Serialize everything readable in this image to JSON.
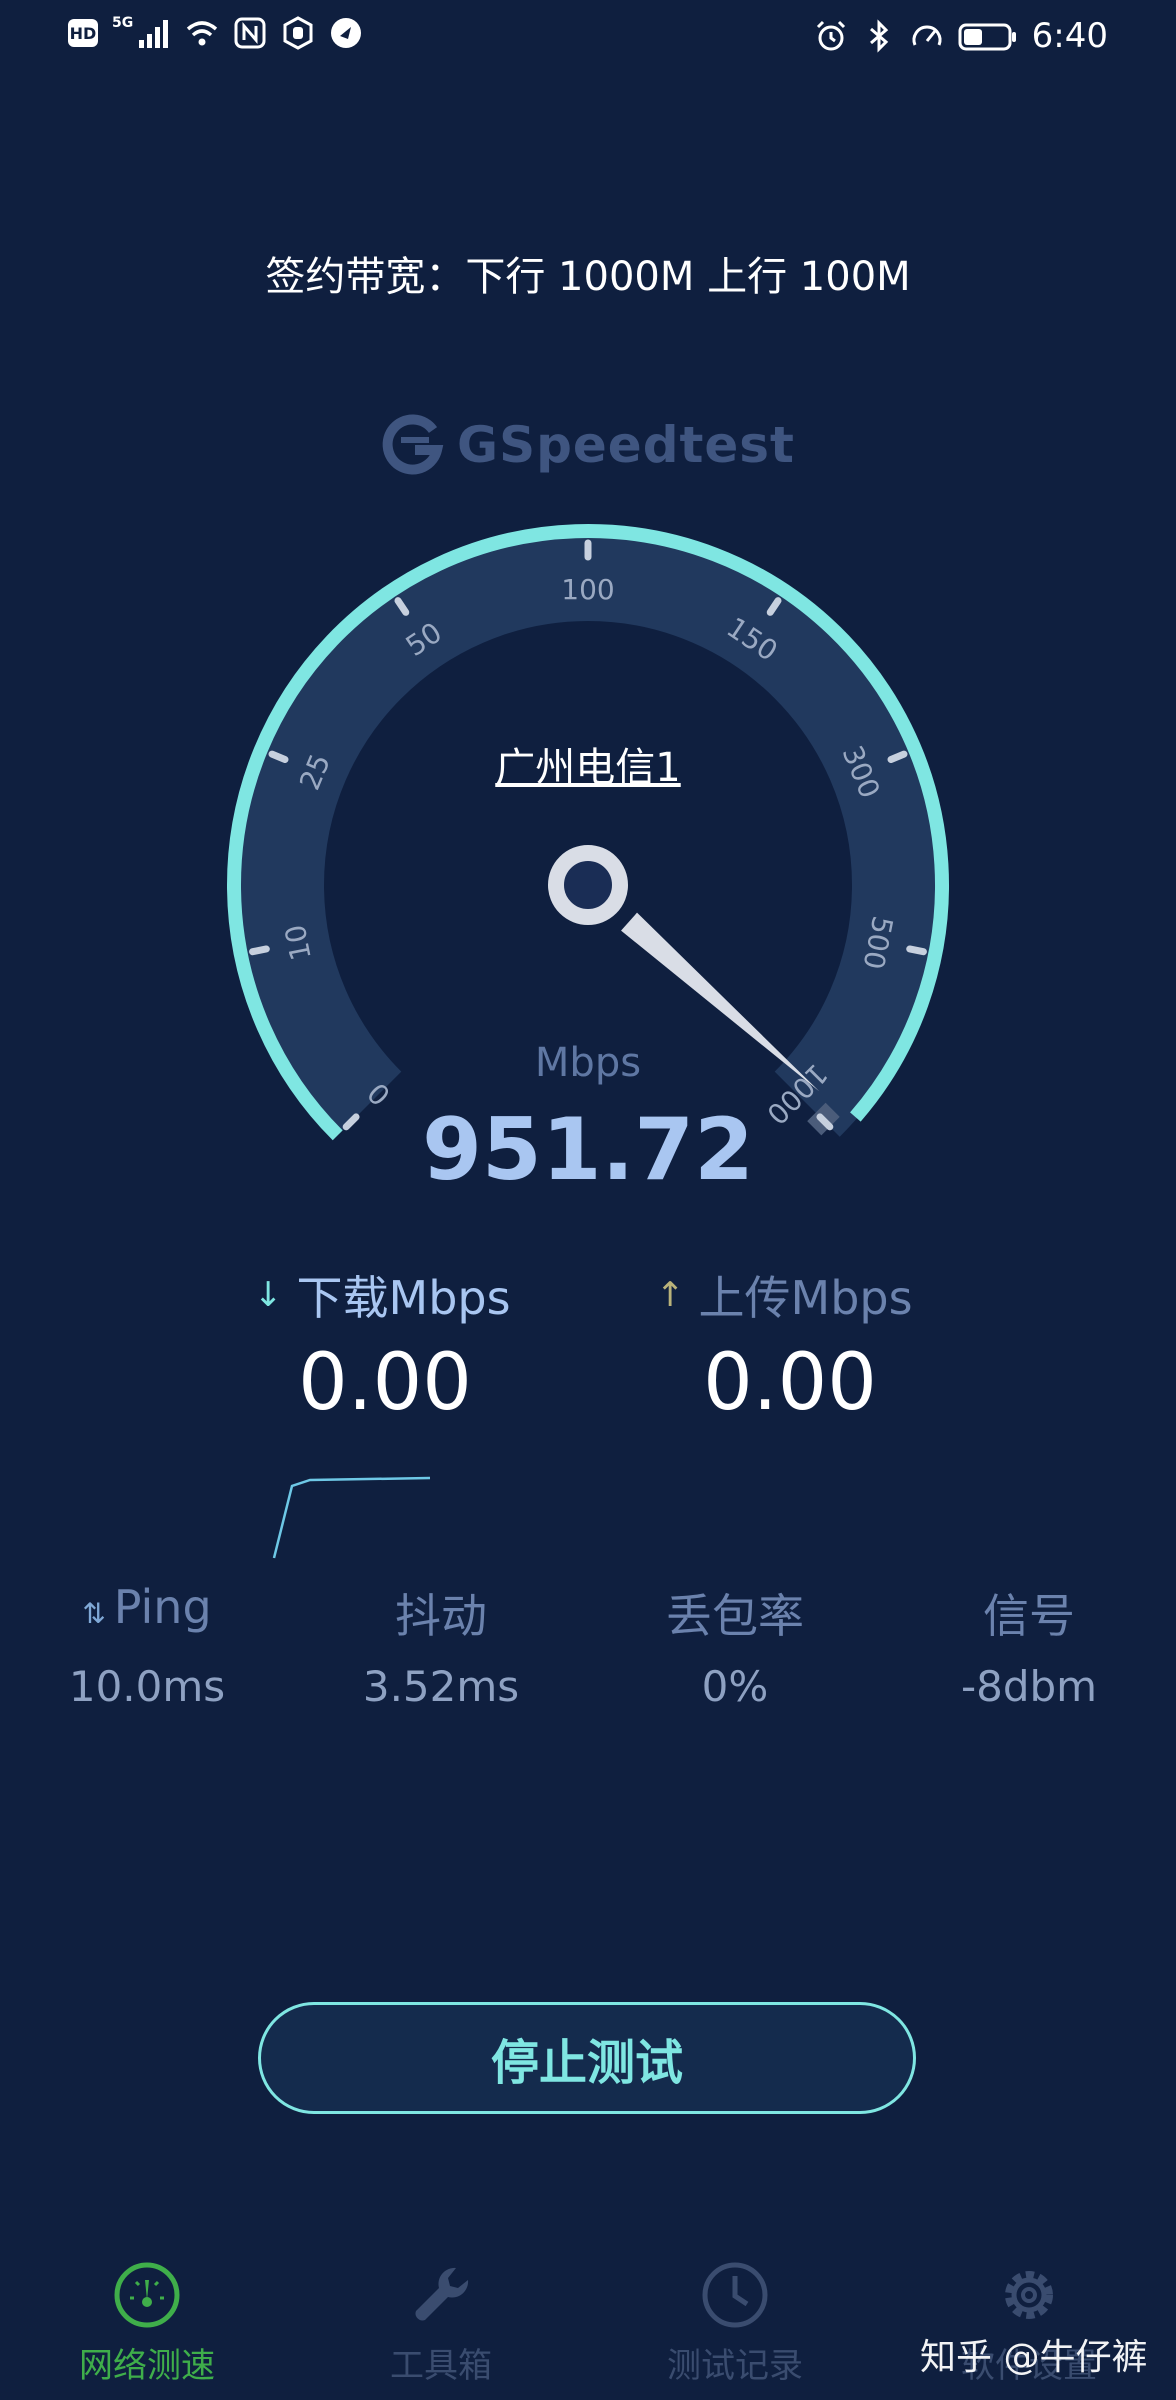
{
  "status_bar": {
    "hd_label": "HD",
    "network_label": "5G",
    "time": "6:40",
    "icons_left": [
      "hd-icon",
      "signal-icon",
      "wifi-icon",
      "nfc-icon",
      "hand-icon",
      "app-icon"
    ],
    "icons_right": [
      "alarm-icon",
      "bluetooth-icon",
      "speed-icon",
      "battery-icon"
    ]
  },
  "bandwidth_text": "签约带宽：下行 1000M  上行 100M",
  "brand": {
    "name": "GSpeedtest",
    "color": "#3f5580"
  },
  "gauge": {
    "server": "广州电信1",
    "unit": "Mbps",
    "value": "951.72",
    "value_number": 951.72,
    "progress": 0.985,
    "tick_labels": [
      "0",
      "10",
      "25",
      "50",
      "100",
      "150",
      "300",
      "500",
      "1000"
    ],
    "accent_color": "#7fe6e2",
    "track_color": "#21395e"
  },
  "download": {
    "label": "下载Mbps",
    "value": "0.00"
  },
  "upload": {
    "label": "上传Mbps",
    "value": "0.00"
  },
  "metrics": [
    {
      "label": "Ping",
      "value": "10.0ms"
    },
    {
      "label": "抖动",
      "value": "3.52ms"
    },
    {
      "label": "丢包率",
      "value": "0%"
    },
    {
      "label": "信号",
      "value": "-8dbm"
    }
  ],
  "stop_button": "停止测试",
  "nav": [
    {
      "label": "网络测速",
      "icon": "speedometer-icon",
      "active": true
    },
    {
      "label": "工具箱",
      "icon": "wrench-icon",
      "active": false
    },
    {
      "label": "测试记录",
      "icon": "clock-icon",
      "active": false
    },
    {
      "label": "软件设置",
      "icon": "gear-icon",
      "active": false
    }
  ],
  "watermark": "知乎 @牛仔裤",
  "colors": {
    "background": "#0f1f3f",
    "accent": "#7fe6e2",
    "active_nav": "#3fae4a"
  }
}
